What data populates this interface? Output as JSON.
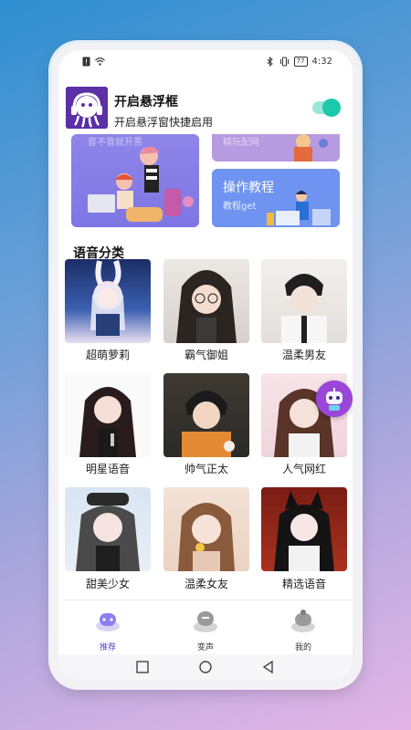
{
  "status_bar": {
    "battery": "77",
    "time": "4:32"
  },
  "float_notice": {
    "title": "开启悬浮框",
    "subtitle": "开启悬浮窗快捷启用",
    "toggle_on": true
  },
  "banners": {
    "left_faint_text": "音不音就开黑",
    "right_top_faint_text": "精玩配网",
    "tutorial_title": "操作教程",
    "tutorial_subtitle": "教程get"
  },
  "section": {
    "title": "语音分类"
  },
  "voice_categories": [
    {
      "label": "超萌萝莉"
    },
    {
      "label": "霸气御姐"
    },
    {
      "label": "温柔男友"
    },
    {
      "label": "明星语音"
    },
    {
      "label": "帅气正太"
    },
    {
      "label": "人气网红"
    },
    {
      "label": "甜美少女"
    },
    {
      "label": "温柔女友"
    },
    {
      "label": "精选语音"
    }
  ],
  "tabs": [
    {
      "label": "推荐",
      "icon": "recommend-icon",
      "active": true
    },
    {
      "label": "变声",
      "icon": "voice-changer-icon",
      "active": false
    },
    {
      "label": "我的",
      "icon": "profile-icon",
      "active": false
    }
  ],
  "colors": {
    "accent": "#5a45c8",
    "toggle": "#1dc9ac",
    "tutorial_banner": "#6f93f0",
    "left_banner": "#8f85e8"
  }
}
